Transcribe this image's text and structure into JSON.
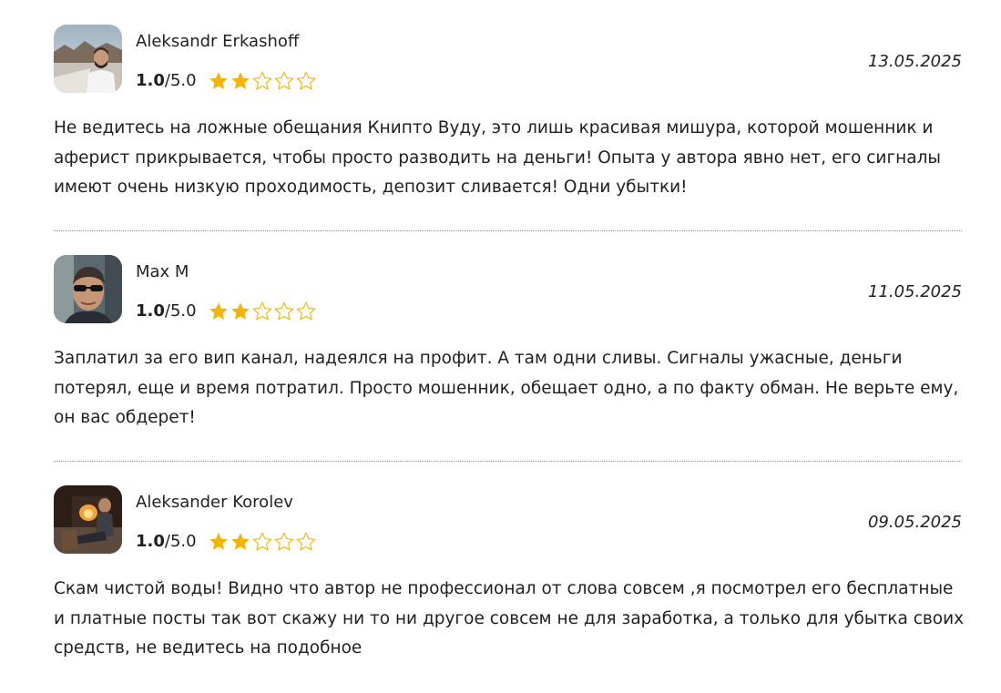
{
  "colors": {
    "star_filled": "#f5b400",
    "star_empty_stroke": "#f5b400",
    "divider": "#8d8d8d"
  },
  "reviews": [
    {
      "author": "Aleksandr Erkashoff",
      "score_value": "1.0",
      "score_max": "/5.0",
      "stars_filled": 2,
      "stars_total": 5,
      "date": "13.05.2025",
      "text": "Не ведитесь на ложные обещания Книпто Вуду, это лишь красивая мишура, которой мошенник и аферист прикрывается, чтобы просто разводить на деньги! Опыта у автора явно нет, его сигналы имеют очень низкую проходимость, депозит сливается! Одни убытки!",
      "avatar_icon": "person-photo-avatar"
    },
    {
      "author": "Max M",
      "score_value": "1.0",
      "score_max": "/5.0",
      "stars_filled": 2,
      "stars_total": 5,
      "date": "11.05.2025",
      "text": "Заплатил за его вип канал, надеялся на профит. А там одни сливы. Сигналы ужасные, деньги потерял, еще и время потратил. Просто мошенник, обещает одно, а по факту обман. Не верьте ему, он вас обдерет!",
      "avatar_icon": "person-photo-avatar"
    },
    {
      "author": "Aleksander Korolev",
      "score_value": "1.0",
      "score_max": "/5.0",
      "stars_filled": 2,
      "stars_total": 5,
      "date": "09.05.2025",
      "text": "Скам чистой воды! Видно что автор не профессионал от слова совсем ,я посмотрел его бесплатные и платные посты так вот скажу ни то ни другое совсем не для заработка, а только для убытка своих средств, не ведитесь на подобное",
      "avatar_icon": "person-photo-avatar"
    }
  ]
}
